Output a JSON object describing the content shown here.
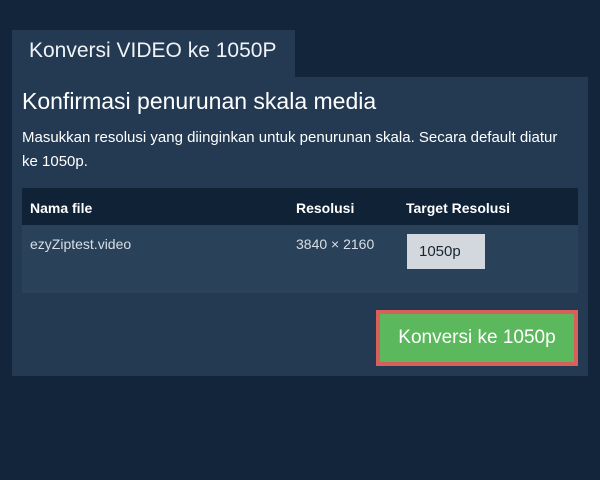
{
  "tab": {
    "title": "Konversi VIDEO ke 1050P"
  },
  "panel": {
    "heading": "Konfirmasi penurunan skala media",
    "description": "Masukkan resolusi yang diinginkan untuk penurunan skala. Secara default diatur ke 1050p."
  },
  "table": {
    "headers": {
      "filename": "Nama file",
      "resolution": "Resolusi",
      "target": "Target Resolusi"
    },
    "rows": [
      {
        "filename": "ezyZiptest.video",
        "resolution": "3840 × 2160",
        "target": "1050p"
      }
    ]
  },
  "actions": {
    "convert_label": "Konversi ke 1050p"
  },
  "colors": {
    "background": "#13253b",
    "panel": "#233a52",
    "table_header": "#0f2236",
    "button": "#5bb85c",
    "button_border": "#d6615b"
  }
}
